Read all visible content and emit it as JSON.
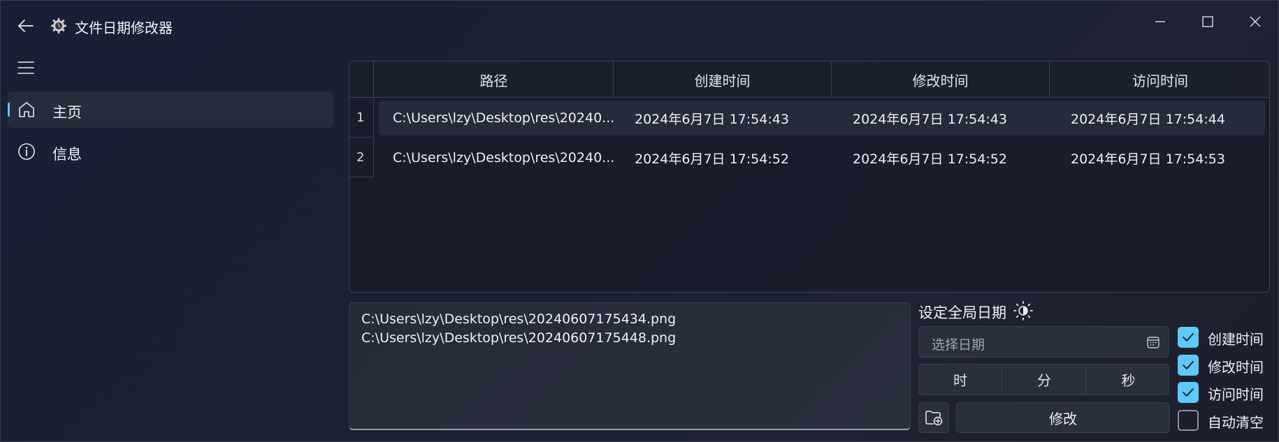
{
  "window": {
    "title": "文件日期修改器",
    "icons": {
      "back": "arrow-left-icon",
      "app": "gear-clock-icon",
      "minimize": "minimize-icon",
      "maximize": "maximize-icon",
      "close": "close-icon"
    }
  },
  "sidebar": {
    "menu_icon": "hamburger-icon",
    "items": [
      {
        "label": "主页",
        "icon": "home-icon",
        "active": true
      },
      {
        "label": "信息",
        "icon": "info-icon",
        "active": false
      }
    ]
  },
  "table": {
    "columns": [
      "路径",
      "创建时间",
      "修改时间",
      "访问时间"
    ],
    "rows": [
      {
        "num": "1",
        "path": "C:\\Users\\lzy\\Desktop\\res\\20240...",
        "created": "2024年6月7日 17:54:43",
        "modified": "2024年6月7日 17:54:43",
        "accessed": "2024年6月7日 17:54:44"
      },
      {
        "num": "2",
        "path": "C:\\Users\\lzy\\Desktop\\res\\20240...",
        "created": "2024年6月7日 17:54:52",
        "modified": "2024年6月7日 17:54:52",
        "accessed": "2024年6月7日 17:54:53"
      }
    ]
  },
  "paths_box": {
    "lines": [
      "C:\\Users\\lzy\\Desktop\\res\\20240607175434.png",
      "C:\\Users\\lzy\\Desktop\\res\\20240607175448.png"
    ]
  },
  "global_date": {
    "title": "设定全局日期",
    "theme_icon": "brightness-icon",
    "date_placeholder": "选择日期",
    "calendar_icon": "calendar-icon",
    "time_segments": [
      "时",
      "分",
      "秒"
    ],
    "folder_icon": "folder-add-icon",
    "modify_label": "修改"
  },
  "options": [
    {
      "label": "创建时间",
      "checked": true
    },
    {
      "label": "修改时间",
      "checked": true
    },
    {
      "label": "访问时间",
      "checked": true
    },
    {
      "label": "自动清空",
      "checked": false
    }
  ],
  "colors": {
    "accent": "#5ec8f8",
    "background": "#1b2132",
    "panel": "#2a2f3c"
  }
}
